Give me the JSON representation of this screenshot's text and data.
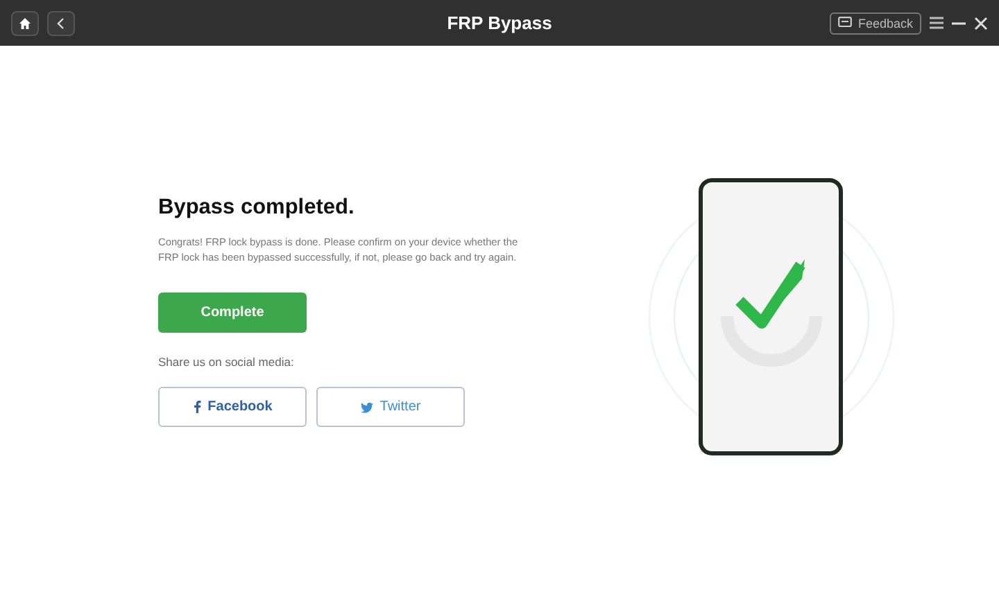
{
  "window": {
    "title": "FRP Bypass",
    "feedback": "Feedback"
  },
  "heading": "Bypass completed.",
  "message": "Congrats! FRP lock bypass is done. Please confirm on your device whether the FRP lock has been bypassed successfully, if not, please go back and try again.",
  "complete_button": "Complete",
  "share_label": "Share us on social media:",
  "share_buttons": [
    {
      "kind": "facebook",
      "label": "Facebook"
    },
    {
      "kind": "twitter",
      "label": "Twitter"
    }
  ]
}
